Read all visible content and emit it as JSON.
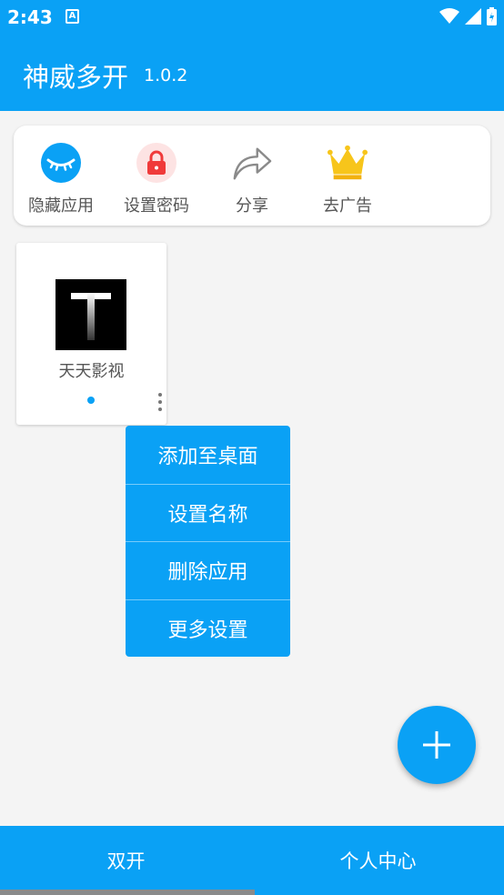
{
  "status_bar": {
    "time": "2:43",
    "notification_glyph": "A"
  },
  "app_bar": {
    "title": "神威多开",
    "version": "1.0.2"
  },
  "quick_actions": [
    {
      "label": "隐藏应用",
      "icon": "closed-eye-icon"
    },
    {
      "label": "设置密码",
      "icon": "lock-icon"
    },
    {
      "label": "分享",
      "icon": "share-icon"
    },
    {
      "label": "去广告",
      "icon": "crown-icon"
    }
  ],
  "app_card": {
    "name": "天天影视",
    "icon_letter": "T"
  },
  "context_menu": [
    "添加至桌面",
    "设置名称",
    "删除应用",
    "更多设置"
  ],
  "bottom_nav": {
    "tab1": "双开",
    "tab2": "个人中心"
  },
  "colors": {
    "primary": "#0aa1f5",
    "lock_red": "#f03a3a",
    "crown_gold": "#f7c51b"
  }
}
